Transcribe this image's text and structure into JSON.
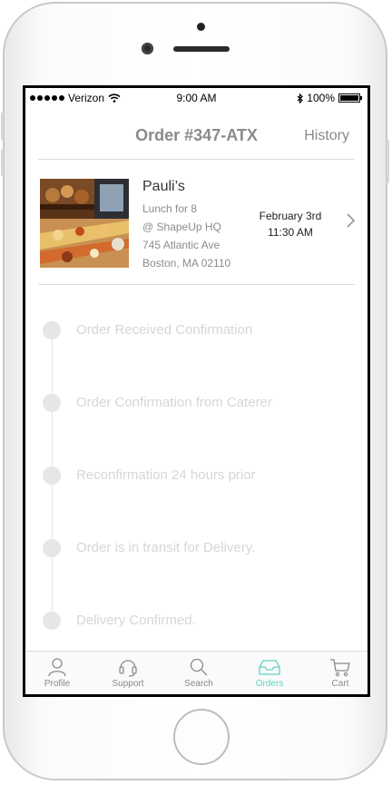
{
  "status_bar": {
    "carrier": "Verizon",
    "time": "9:00 AM",
    "battery": "100%"
  },
  "header": {
    "title": "Order #347-ATX",
    "history_label": "History"
  },
  "order": {
    "restaurant": "Pauli’s",
    "details": [
      "Lunch for 8",
      "@ ShapeUp HQ",
      "745 Atlantic Ave",
      "Boston, MA 02110"
    ],
    "date": "February 3rd",
    "time": "11:30 AM"
  },
  "timeline": {
    "steps": [
      "Order Received Confirmation",
      "Order Confirmation from Caterer",
      "Reconfirmation 24 hours prior",
      "Order is in transit for Delivery.",
      "Delivery Confirmed."
    ]
  },
  "tabbar": {
    "tabs": [
      {
        "label": "Profile",
        "icon": "user-icon"
      },
      {
        "label": "Support",
        "icon": "headset-icon"
      },
      {
        "label": "Search",
        "icon": "search-icon"
      },
      {
        "label": "Orders",
        "icon": "inbox-icon",
        "active": true
      },
      {
        "label": "Cart",
        "icon": "cart-icon"
      }
    ]
  },
  "colors": {
    "accent": "#5ed3c6",
    "muted_text": "#8a8a8a",
    "inactive_step": "#d6d6d6"
  }
}
